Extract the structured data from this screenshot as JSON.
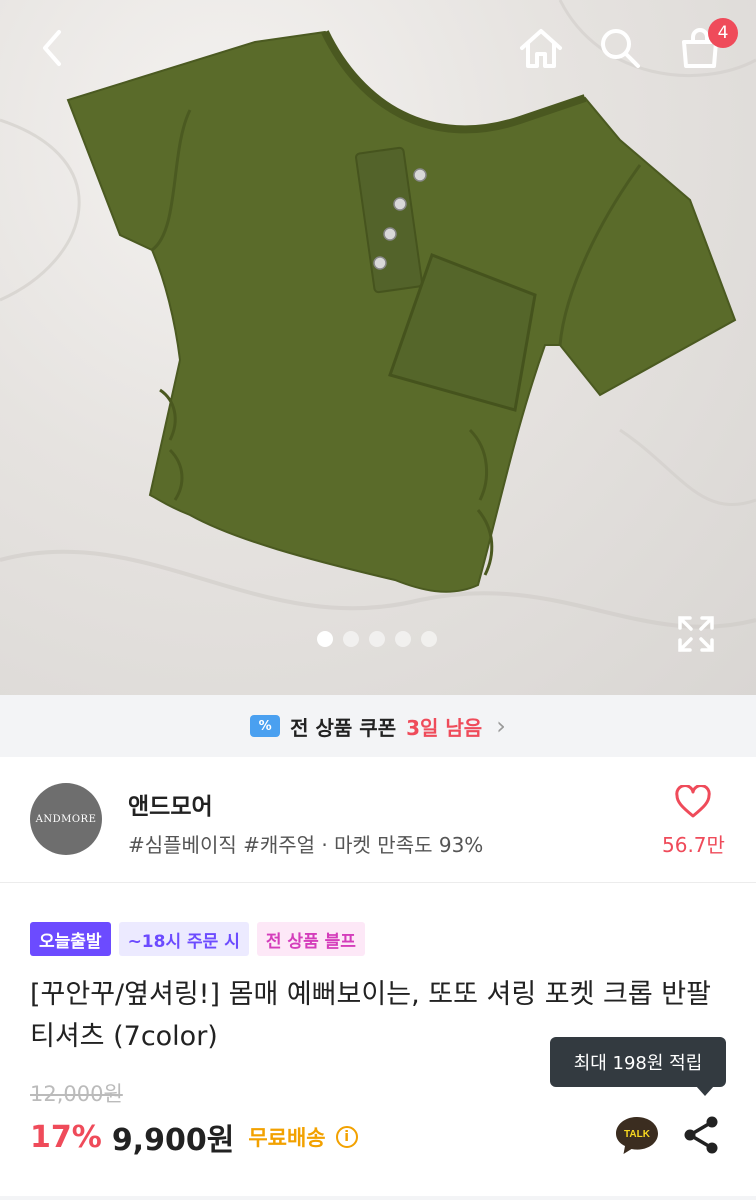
{
  "header": {
    "cart_count": "4"
  },
  "gallery": {
    "dot_count": 5,
    "active_index": 0
  },
  "coupon": {
    "text": "전 상품 쿠폰",
    "remaining": "3일 남음"
  },
  "shop": {
    "logo_text": "ANDMORE",
    "name": "앤드모어",
    "tags": "#심플베이직 #캐주얼 · 마켓 만족도 93%",
    "likes": "56.7만"
  },
  "product": {
    "tags": [
      "오늘출발",
      "~18시 주문 시",
      "전 상품 블프"
    ],
    "title": "[꾸안꾸/옆셔링!] 몸매 예뻐보이는, 또또 셔링 포켓 크롭 반팔티셔츠 (7color)",
    "points_tooltip": "최대 198원 적립",
    "original_price": "12,000원",
    "discount": "17%",
    "price": "9,900원",
    "shipping": "무료배송",
    "talk_label": "TALK"
  },
  "colors": {
    "accent_red": "#ef4b5a",
    "shirt_green": "#5a6b2a",
    "shipping_orange": "#f2a100",
    "tag_purple": "#6c4bff"
  }
}
